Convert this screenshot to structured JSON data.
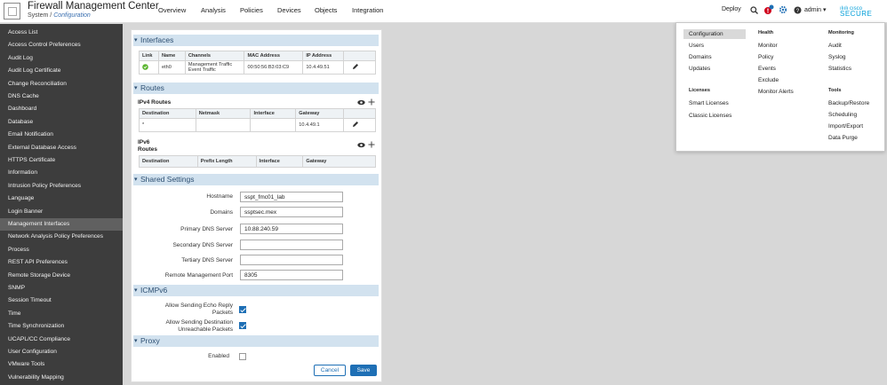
{
  "header": {
    "title": "Firewall Management Center",
    "breadcrumb_parent": "System",
    "breadcrumb_sep": " / ",
    "breadcrumb_current": "Configuration",
    "nav": [
      "Overview",
      "Analysis",
      "Policies",
      "Devices",
      "Objects",
      "Integration"
    ],
    "deploy": "Deploy",
    "user": "admin",
    "user_caret": "▾",
    "brand_small": "ılıılı cısco",
    "brand": "SECURE",
    "colors": {
      "accent": "#1e6fb5",
      "brand": "#049fd9",
      "alert": "#d0021b"
    }
  },
  "sidebar": {
    "items": [
      "Access List",
      "Access Control Preferences",
      "Audit Log",
      "Audit Log Certificate",
      "Change Reconciliation",
      "DNS Cache",
      "Dashboard",
      "Database",
      "Email Notification",
      "External Database Access",
      "HTTPS Certificate",
      "Information",
      "Intrusion Policy Preferences",
      "Language",
      "Login Banner",
      "Management Interfaces",
      "Network Analysis Policy Preferences",
      "Process",
      "REST API Preferences",
      "Remote Storage Device",
      "SNMP",
      "Session Timeout",
      "Time",
      "Time Synchronization",
      "UCAPL/CC Compliance",
      "User Configuration",
      "VMware Tools",
      "Vulnerability Mapping"
    ],
    "active": "Management Interfaces"
  },
  "interfaces": {
    "title": "Interfaces",
    "columns": [
      "Link",
      "Name",
      "Channels",
      "MAC Address",
      "IP Address"
    ],
    "row": {
      "name": "eth0",
      "channel1": "Management Traffic",
      "channel2": "Event Traffic",
      "mac": "00:50:56:B3:03:C9",
      "ip": "10.4.49.51"
    }
  },
  "routes": {
    "title": "Routes",
    "ipv4_title": "IPv4 Routes",
    "ipv4_columns": [
      "Destination",
      "Netmask",
      "Interface",
      "Gateway"
    ],
    "ipv4_row": {
      "destination": "*",
      "gateway": "10.4.49.1"
    },
    "ipv6_title_1": "IPv6",
    "ipv6_title_2": "Routes",
    "ipv6_columns": [
      "Destination",
      "Prefix Length",
      "Interface",
      "Gateway"
    ]
  },
  "shared": {
    "title": "Shared Settings",
    "fields": [
      {
        "label": "Hostname",
        "value": "sspt_fmc01_lab"
      },
      {
        "label": "Domains",
        "value": "ssptsec.mex"
      },
      {
        "label": "Primary DNS Server",
        "value": "10.88.240.59"
      },
      {
        "label": "Secondary DNS Server",
        "value": ""
      },
      {
        "label": "Tertiary DNS Server",
        "value": ""
      },
      {
        "label": "Remote Management Port",
        "value": "8305"
      }
    ]
  },
  "icmpv6": {
    "title": "ICMPv6",
    "echo_label_1": "Allow Sending Echo Reply",
    "echo_label_2": "Packets",
    "unreach_label_1": "Allow Sending Destination",
    "unreach_label_2": "Unreachable Packets"
  },
  "proxy": {
    "title": "Proxy",
    "enabled_label": "Enabled"
  },
  "buttons": {
    "cancel": "Cancel",
    "save": "Save"
  },
  "dropdown": {
    "col1": [
      "Configuration",
      "Users",
      "Domains",
      "Updates"
    ],
    "licenses_head": "Licenses",
    "licenses": [
      "Smart Licenses",
      "Classic Licenses"
    ],
    "health_head": "Health",
    "health": [
      "Monitor",
      "Policy",
      "Events",
      "Exclude",
      "Monitor Alerts"
    ],
    "monitoring_head": "Monitoring",
    "monitoring": [
      "Audit",
      "Syslog",
      "Statistics"
    ],
    "tools_head": "Tools",
    "tools": [
      "Backup/Restore",
      "Scheduling",
      "Import/Export",
      "Data Purge"
    ]
  }
}
